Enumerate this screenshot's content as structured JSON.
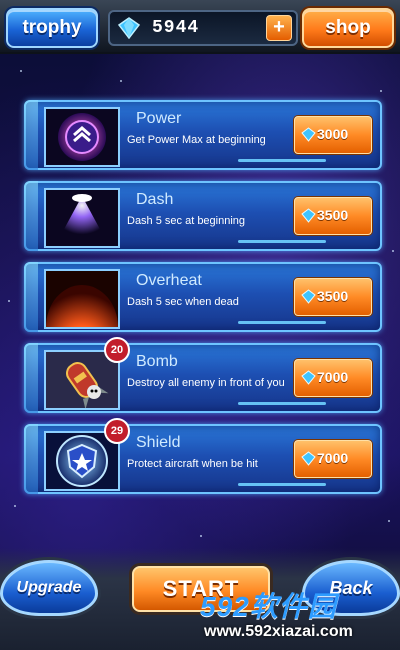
{
  "topbar": {
    "trophy_label": "trophy",
    "shop_label": "shop",
    "gem_count": "5944",
    "plus_label": "+"
  },
  "items": [
    {
      "name": "Power",
      "desc": "Get Power Max at beginning",
      "price": "3000",
      "icon": "power-chevrons-icon"
    },
    {
      "name": "Dash",
      "desc": "Dash 5 sec at beginning",
      "price": "3500",
      "icon": "dash-beam-icon"
    },
    {
      "name": "Overheat",
      "desc": "Dash 5 sec when dead",
      "price": "3500",
      "icon": "overheat-flame-icon"
    },
    {
      "name": "Bomb",
      "desc": "Destroy all enemy in front of you",
      "price": "7000",
      "badge": "20",
      "icon": "bomb-icon"
    },
    {
      "name": "Shield",
      "desc": "Protect aircraft when be hit",
      "price": "7000",
      "badge": "29",
      "icon": "shield-icon"
    }
  ],
  "bottom": {
    "upgrade_label": "Upgrade",
    "start_label": "START",
    "back_label": "Back"
  },
  "watermark": {
    "logo": "592软件园",
    "url": "www.592xiazai.com"
  },
  "colors": {
    "card_blue": "#1d4fb2",
    "price_orange": "#ff8a25",
    "trophy_blue": "#1a64d6",
    "shop_orange": "#ff7a1a"
  }
}
